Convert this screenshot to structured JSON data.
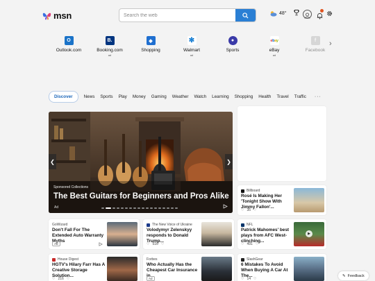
{
  "header": {
    "logo_text": "msn",
    "search_placeholder": "Search the web",
    "weather_temp": "48°"
  },
  "quick_links": [
    {
      "label": "Outlook.com",
      "icon": "outlook-icon",
      "ad": "",
      "color": "#1a73c8"
    },
    {
      "label": "Booking.com",
      "icon": "booking-icon",
      "ad": "ad",
      "color": "#003580"
    },
    {
      "label": "Shopping",
      "icon": "shopping-tag-icon",
      "ad": "",
      "color": "#1f6fd0"
    },
    {
      "label": "Walmart",
      "icon": "walmart-icon",
      "ad": "ad",
      "color": "#0071ce"
    },
    {
      "label": "Sports",
      "icon": "sports-ball-icon",
      "ad": "",
      "color": "#3a3aa8"
    },
    {
      "label": "eBay",
      "icon": "ebay-icon",
      "ad": "ad",
      "color": "#e53238"
    },
    {
      "label": "Facebook",
      "icon": "facebook-icon",
      "ad": "",
      "color": "#c8c8c8"
    }
  ],
  "nav": {
    "items": [
      "Discover",
      "News",
      "Sports",
      "Play",
      "Money",
      "Gaming",
      "Weather",
      "Watch",
      "Learning",
      "Shopping",
      "Health",
      "Travel",
      "Traffic"
    ],
    "more": "···"
  },
  "hero": {
    "sponsor": "Sponsored Collections",
    "title": "The Best Guitars for Beginners and Pros Alike",
    "ad": "Ad",
    "prev": "❮",
    "next": "❯"
  },
  "cards": [
    {
      "source": "Billboard",
      "title": "Rosé Is Making Her 'Tonight Show With Jimmy Fallon'...",
      "likes": "35",
      "ad": ""
    },
    {
      "source": "GoWizard",
      "title": "Don't Fall For The Extended Auto Warranty Myths",
      "likes": "",
      "ad": "Ad"
    },
    {
      "source": "The New Voice of Ukraine",
      "title": "Volodymyr Zelenskyy responds to Donald Trump...",
      "likes": "516",
      "ad": ""
    },
    {
      "source": "NFL",
      "title": "Patrick Mahomes' best plays from AFC West-clinching...",
      "likes": "491",
      "ad": ""
    },
    {
      "source": "House Digest",
      "title": "HGTV's Hilary Farr Has A Creative Storage Solution...",
      "likes": "216",
      "ad": ""
    },
    {
      "source": "Forbes",
      "title": "Who Actually Has the Cheapest Car Insurance in...",
      "likes": "",
      "ad": "Ad"
    },
    {
      "source": "SlashGear",
      "title": "6 Mistakes To Avoid When Buying A Car At The...",
      "likes": "14",
      "ad": ""
    }
  ],
  "feedback": "Feedback"
}
